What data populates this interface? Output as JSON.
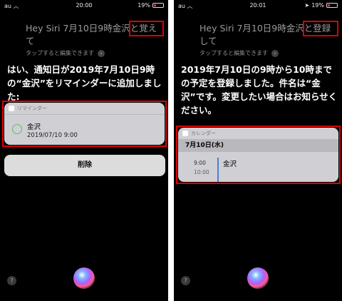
{
  "left": {
    "status": {
      "carrier": "au",
      "time": "20:00",
      "battery": "19%"
    },
    "query": "Hey Siri 7月10日9時金沢と覚えて",
    "hint": "タップすると編集できます",
    "answer": "はい、通知日が2019年7月10日9時の“金沢”をリマインダーに追加しました:",
    "reminder": {
      "app": "リマインダー",
      "title": "金沢",
      "datetime": "2019/07/10 9:00"
    },
    "delete_label": "削除",
    "help": "?"
  },
  "right": {
    "status": {
      "carrier": "au",
      "time": "20:01",
      "battery": "19%"
    },
    "query": "Hey Siri 7月10日9時金沢と登録して",
    "hint": "タップすると編集できます",
    "answer": "2019年7月10日の9時から10時までの予定を登録しました。件名は“金沢”です。変更したい場合はお知らせください。",
    "calendar": {
      "app": "カレンダー",
      "date": "7月10日(水)",
      "start": "9:00",
      "end": "10:00",
      "title": "金沢"
    },
    "help": "?"
  },
  "colors": {
    "highlight": "#e00000",
    "reminder_circle": "#5fbf5a",
    "event_bar": "#4a7fd8"
  },
  "icons": [
    "wifi-icon",
    "battery-icon",
    "location-icon",
    "chevron-right-icon",
    "reminders-app-icon",
    "calendar-app-icon",
    "help-icon",
    "siri-orb-icon"
  ]
}
